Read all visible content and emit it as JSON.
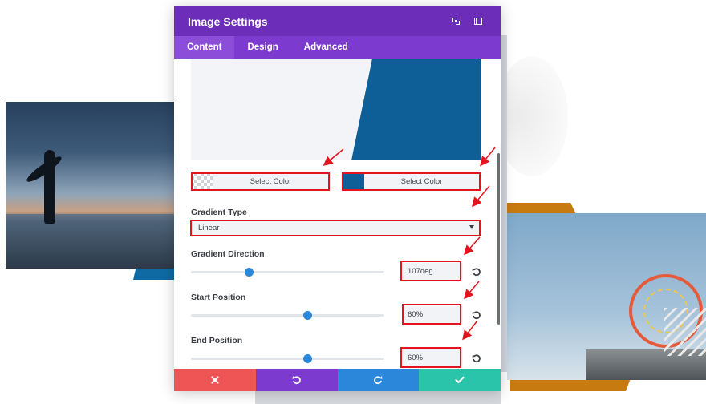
{
  "modal": {
    "title": "Image Settings",
    "expand_icon": "expand-icon",
    "sidebar_icon": "sidebar-icon"
  },
  "tabs": [
    {
      "label": "Content",
      "active": true
    },
    {
      "label": "Design",
      "active": false
    },
    {
      "label": "Advanced",
      "active": false
    }
  ],
  "gradient": {
    "color_1": {
      "label": "Select Color",
      "swatch": "transparent"
    },
    "color_2": {
      "label": "Select Color",
      "swatch": "#0e5f97"
    },
    "type": {
      "label": "Gradient Type",
      "value": "Linear"
    },
    "direction": {
      "label": "Gradient Direction",
      "value": "107deg",
      "slider_fraction": 0.3
    },
    "start": {
      "label": "Start Position",
      "value": "60%",
      "slider_fraction": 0.6
    },
    "end": {
      "label": "End Position",
      "value": "60%",
      "slider_fraction": 0.6
    }
  },
  "colors": {
    "header": "#6c2eb9",
    "tabs": "#7d3acf",
    "accent_blue": "#2b87da",
    "preview_blue": "#0e5f97",
    "annotation_red": "#e3141d",
    "cancel": "#ef5555",
    "undo": "#7d3acf",
    "redo": "#2b87da",
    "save": "#29c4a9"
  },
  "footer": {
    "cancel_icon": "close-icon",
    "undo_icon": "undo-icon",
    "redo_icon": "redo-icon",
    "save_icon": "check-icon"
  }
}
